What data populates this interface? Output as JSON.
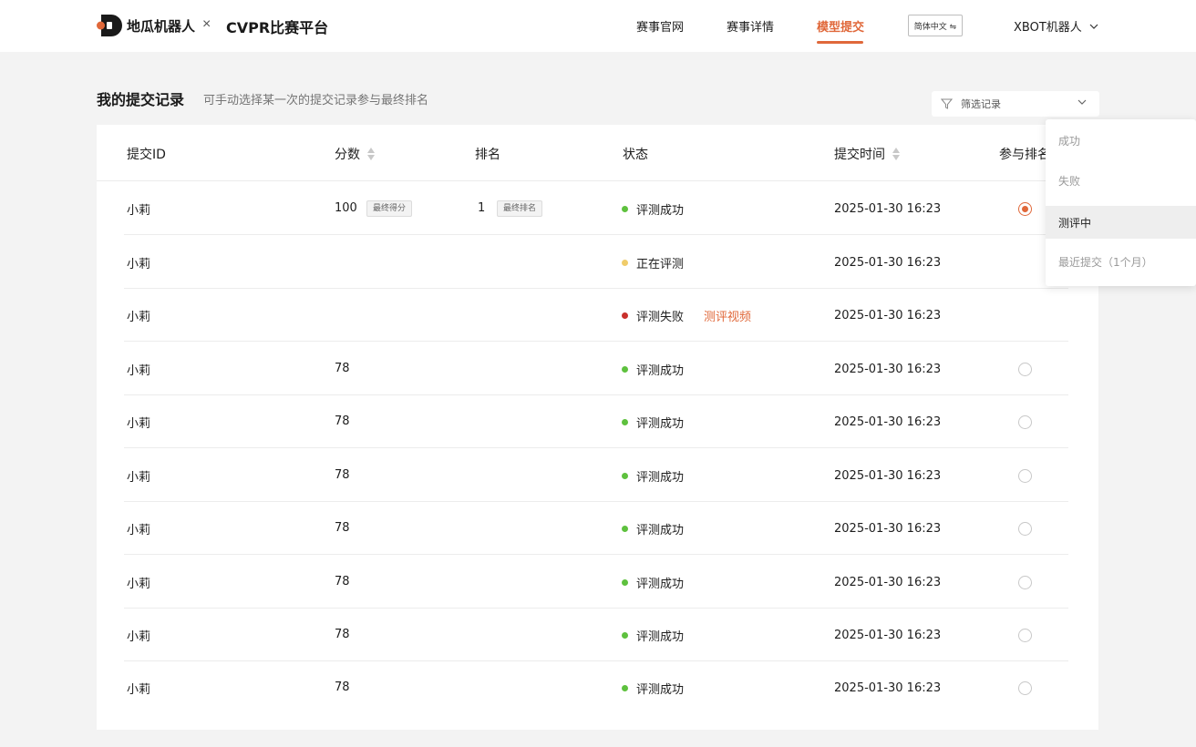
{
  "header": {
    "brand": "地瓜机器人",
    "separator": "×",
    "platform": "CVPR比赛平台",
    "nav": [
      "赛事官网",
      "赛事详情",
      "模型提交"
    ],
    "active_nav": "模型提交",
    "lang_label": "简体中文 ⇋",
    "user": "XBOT机器人",
    "brand_color": "#e0683a"
  },
  "section": {
    "title": "我的提交记录",
    "subtitle": "可手动选择某一次的提交记录参与最终排名"
  },
  "filter": {
    "placeholder": "筛选记录",
    "options": [
      "成功",
      "失败",
      "测评中",
      "最近提交（1个月）"
    ],
    "highlighted": "测评中"
  },
  "table": {
    "columns": [
      "提交ID",
      "分数",
      "排名",
      "状态",
      "提交时间",
      "参与排名"
    ],
    "score_tag": "最终得分",
    "rank_tag": "最终排名",
    "rows": [
      {
        "id": "小莉",
        "score": "100",
        "rank": "1",
        "status": "评测成功",
        "status_color": "#5ec13e",
        "time": "2025-01-30 16:23",
        "radio": "checked"
      },
      {
        "id": "小莉",
        "score": "",
        "rank": "",
        "status": "正在评测",
        "status_color": "#f0cc6a",
        "time": "2025-01-30 16:23",
        "radio": "none"
      },
      {
        "id": "小莉",
        "score": "",
        "rank": "",
        "status": "评测失败",
        "status_color": "#c9302c",
        "link": "测评视频",
        "time": "2025-01-30 16:23",
        "radio": "none"
      },
      {
        "id": "小莉",
        "score": "78",
        "rank": "",
        "status": "评测成功",
        "status_color": "#5ec13e",
        "time": "2025-01-30 16:23",
        "radio": "unchecked"
      },
      {
        "id": "小莉",
        "score": "78",
        "rank": "",
        "status": "评测成功",
        "status_color": "#5ec13e",
        "time": "2025-01-30 16:23",
        "radio": "unchecked"
      },
      {
        "id": "小莉",
        "score": "78",
        "rank": "",
        "status": "评测成功",
        "status_color": "#5ec13e",
        "time": "2025-01-30 16:23",
        "radio": "unchecked"
      },
      {
        "id": "小莉",
        "score": "78",
        "rank": "",
        "status": "评测成功",
        "status_color": "#5ec13e",
        "time": "2025-01-30 16:23",
        "radio": "unchecked"
      },
      {
        "id": "小莉",
        "score": "78",
        "rank": "",
        "status": "评测成功",
        "status_color": "#5ec13e",
        "time": "2025-01-30 16:23",
        "radio": "unchecked"
      },
      {
        "id": "小莉",
        "score": "78",
        "rank": "",
        "status": "评测成功",
        "status_color": "#5ec13e",
        "time": "2025-01-30 16:23",
        "radio": "unchecked"
      },
      {
        "id": "小莉",
        "score": "78",
        "rank": "",
        "status": "评测成功",
        "status_color": "#5ec13e",
        "time": "2025-01-30 16:23",
        "radio": "unchecked"
      }
    ]
  }
}
